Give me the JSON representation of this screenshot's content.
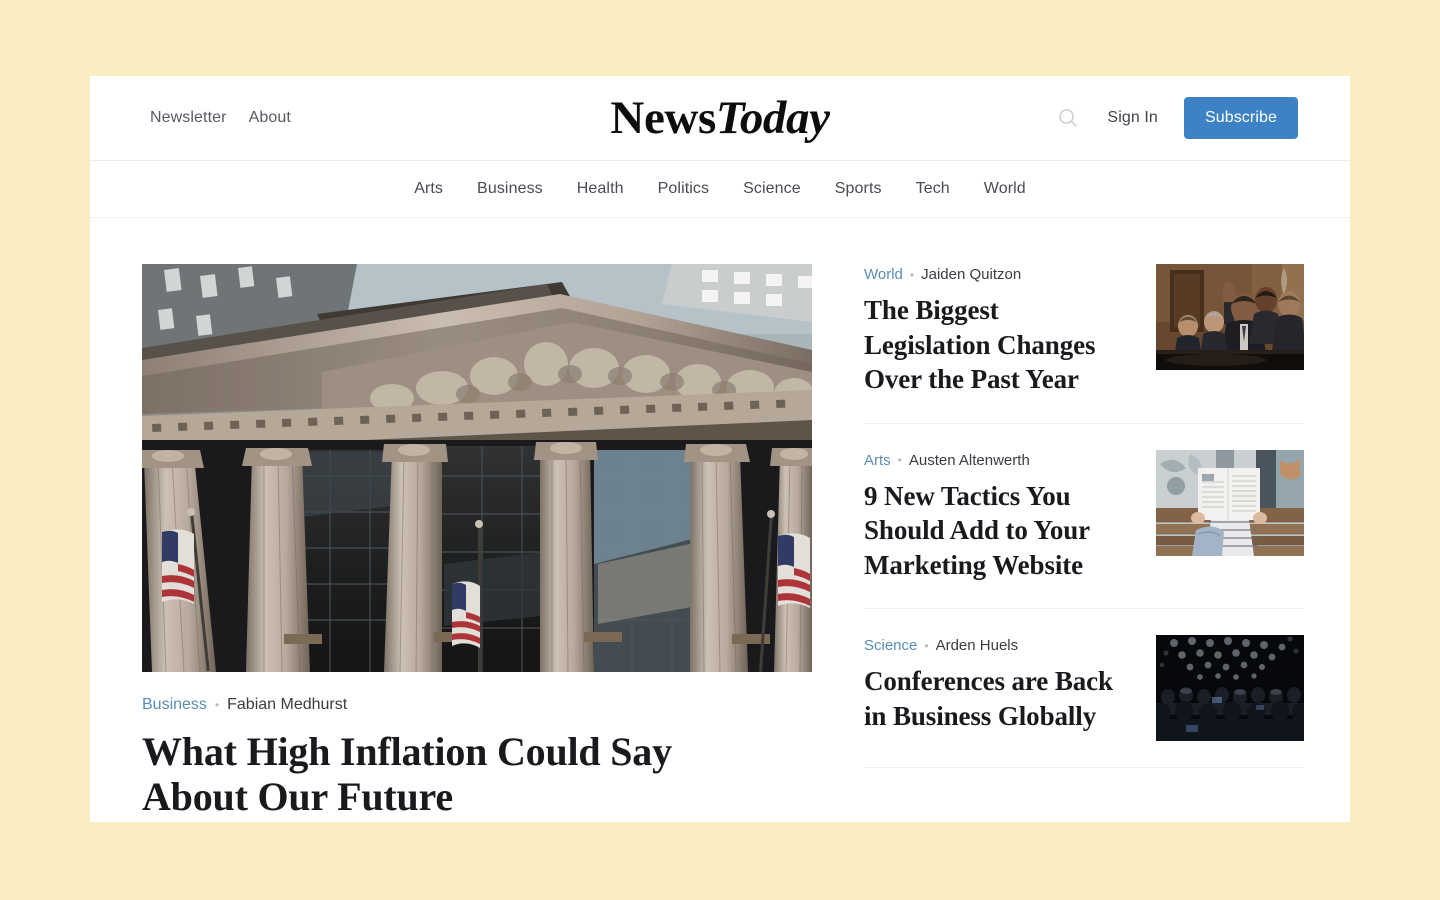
{
  "theme": {
    "page_background": "#faedc2",
    "card_background": "#ffffff",
    "accent_blue": "#3d82c4",
    "category_link": "#5b8db8",
    "headline_color": "#1a1a1e"
  },
  "header": {
    "top_links": [
      {
        "label": "Newsletter",
        "name": "newsletter"
      },
      {
        "label": "About",
        "name": "about"
      }
    ],
    "logo": {
      "part1": "News",
      "part2": "Today"
    },
    "search_icon": "search-icon",
    "sign_in_label": "Sign In",
    "subscribe_label": "Subscribe"
  },
  "category_nav": {
    "items": [
      {
        "label": "Arts"
      },
      {
        "label": "Business"
      },
      {
        "label": "Health"
      },
      {
        "label": "Politics"
      },
      {
        "label": "Science"
      },
      {
        "label": "Sports"
      },
      {
        "label": "Tech"
      },
      {
        "label": "World"
      }
    ]
  },
  "hero": {
    "image_alt": "new-york-stock-exchange-facade",
    "category": "Business",
    "separator": "•",
    "author": "Fabian Medhurst",
    "title": "What High Inflation Could Say About Our Future"
  },
  "sidebar": {
    "articles": [
      {
        "category": "World",
        "separator": "•",
        "author": "Jaiden Quitzon",
        "title": "The Biggest Legislation Changes Over the Past Year",
        "image_alt": "politicians-waving-at-podium"
      },
      {
        "category": "Arts",
        "separator": "•",
        "author": "Austen Altenwerth",
        "title": "9 New Tactics You Should Add to Your Marketing Website",
        "image_alt": "person-reading-newspaper-on-bench"
      },
      {
        "category": "Science",
        "separator": "•",
        "author": "Arden Huels",
        "title": "Conferences are Back in Business Globally",
        "image_alt": "dark-conference-audience"
      }
    ]
  }
}
